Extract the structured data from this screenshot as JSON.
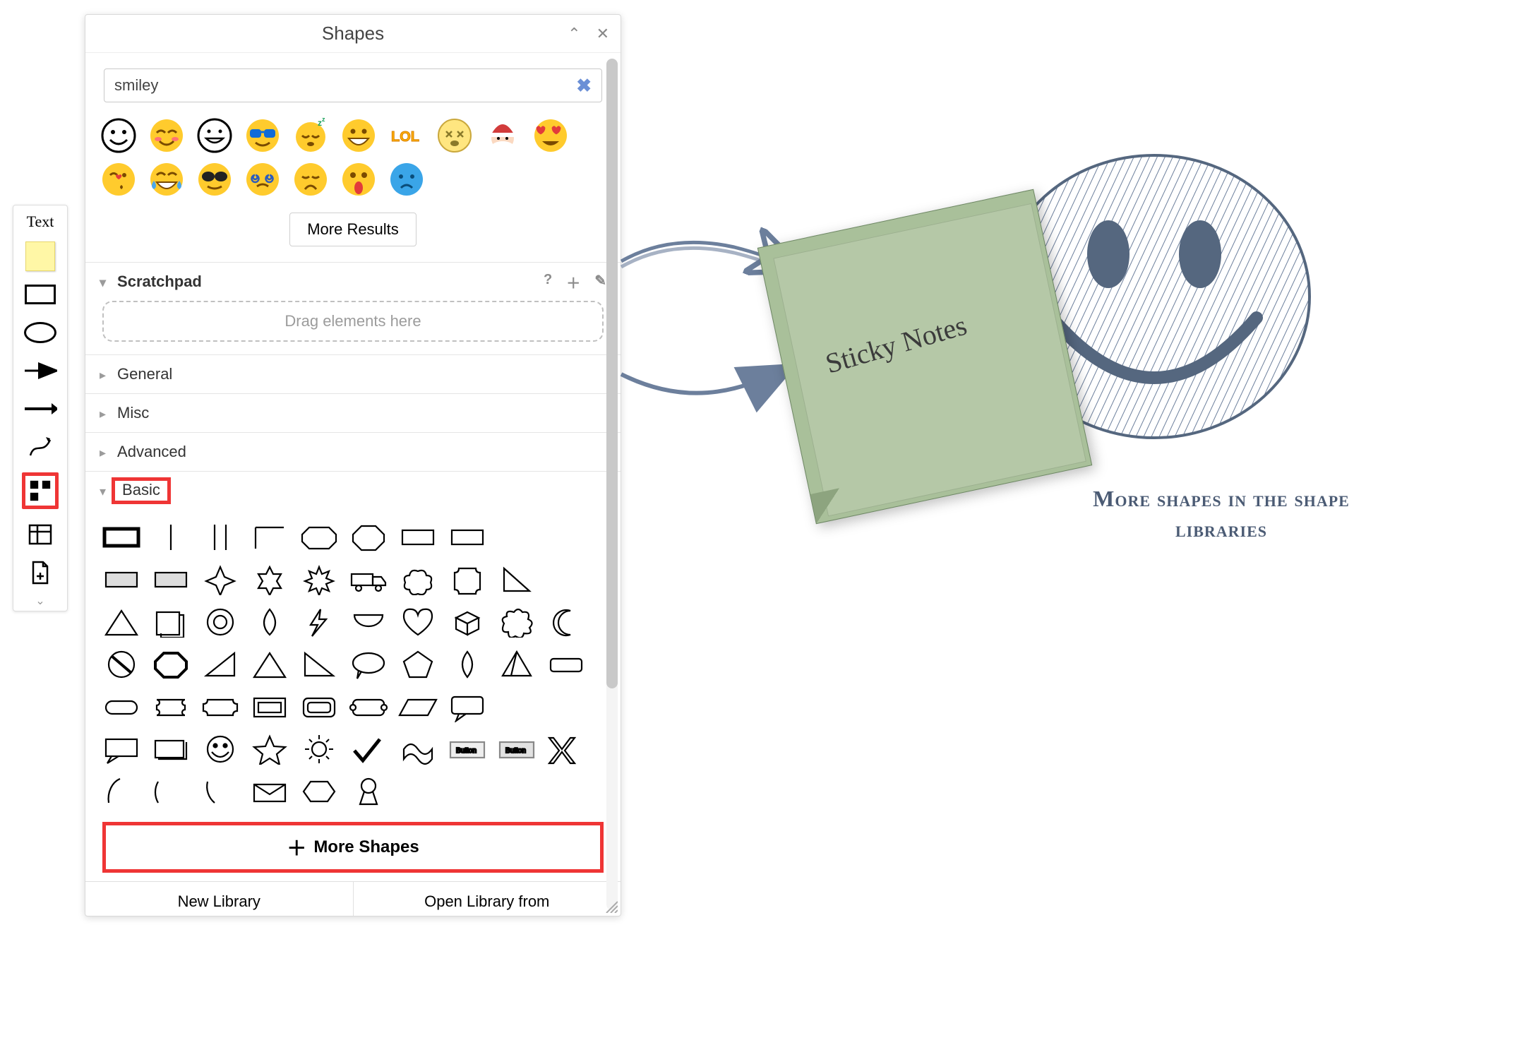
{
  "toolbar": {
    "text_label": "Text",
    "items": [
      "sticky-note",
      "rectangle",
      "ellipse",
      "line",
      "arrow",
      "freehand",
      "shapes",
      "table",
      "new-page"
    ]
  },
  "panel": {
    "title": "Shapes",
    "collapse_icon": "chevron-up",
    "close_icon": "close",
    "search": {
      "value": "smiley",
      "clear_icon": "clear"
    },
    "emoji_icons": [
      "smile-outline",
      "blush",
      "grin-outline",
      "sunglasses-blue",
      "sleepy",
      "grin-wide",
      "lol-text",
      "dizzy",
      "santa",
      "heart-eyes",
      "kiss-heart",
      "joy-tears",
      "sunglasses",
      "spiral-eyes",
      "sad",
      "scream",
      "cold"
    ],
    "more_results_label": "More Results",
    "scratchpad": {
      "label": "Scratchpad",
      "tools": [
        "help",
        "add",
        "edit"
      ],
      "drop_text": "Drag elements here"
    },
    "sections": {
      "general": "General",
      "misc": "Misc",
      "advanced": "Advanced",
      "basic": "Basic"
    },
    "basic_shapes": [
      "rect-hthick",
      "vline",
      "vlines",
      "lcorner",
      "octagon-trim",
      "octagon",
      "rect",
      "rect2",
      "rect-grey",
      "rect-grey2",
      "star4",
      "star6",
      "star8",
      "truck",
      "cloud-burst",
      "plaque",
      "tri-right",
      "triangle",
      "square-shadow",
      "ring",
      "drop",
      "bolt",
      "bowl",
      "heart",
      "cube",
      "splat",
      "moon",
      "no",
      "octagon-th",
      "rt-tri",
      "triangle-2",
      "rt-tri-2",
      "speech-oval",
      "pentagon",
      "lens",
      "pyramid",
      "pill",
      "pill-round",
      "ticket",
      "ticket-2",
      "frame",
      "frame-inset",
      "ticket-3",
      "parallelogram",
      "callout",
      "callout-2",
      "rect-shadow",
      "smiley",
      "star5",
      "sun",
      "check",
      "flag",
      "button-1",
      "button-2",
      "x",
      "arc-1",
      "arc-2",
      "arc-3",
      "envelope",
      "hex",
      "keyhole"
    ],
    "more_shapes_label": "More Shapes",
    "footer": {
      "new_library": "New Library",
      "open_library": "Open Library from"
    }
  },
  "canvas": {
    "sticky_text": "Sticky Notes",
    "caption": "More shapes in the shape libraries"
  }
}
